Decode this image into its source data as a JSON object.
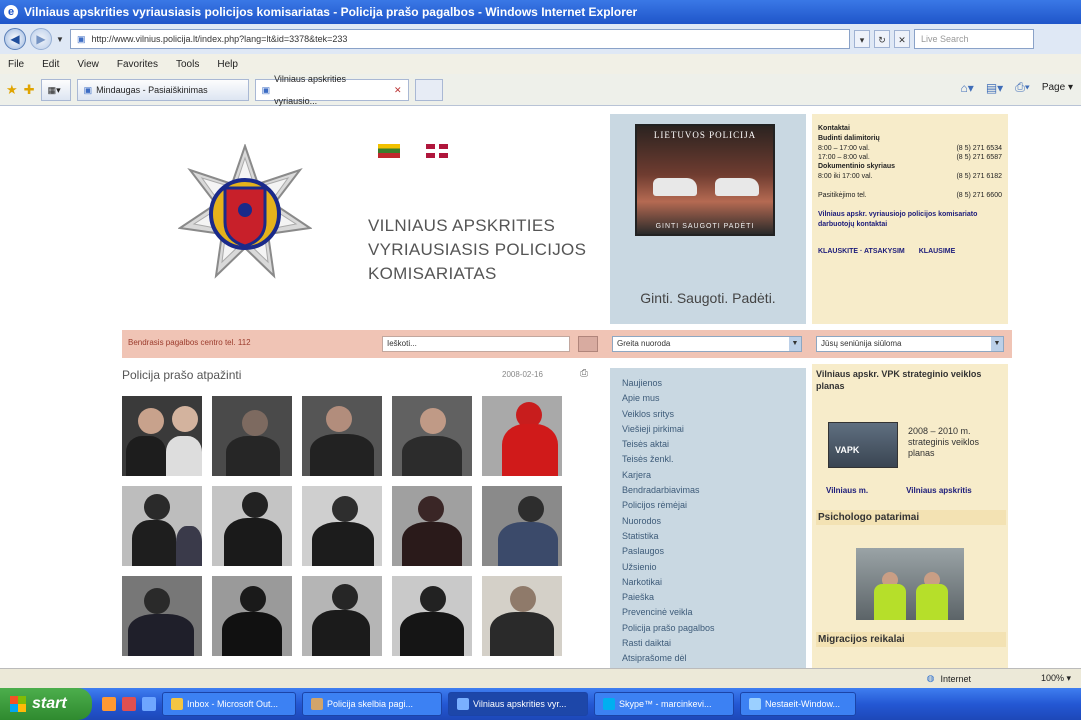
{
  "window": {
    "title": "Vilniaus apskrities vyriausiasis policijos komisariatas - Policija prašo pagalbos - Windows Internet Explorer"
  },
  "address_bar": {
    "url": "http://www.vilnius.policija.lt/index.php?lang=lt&id=3378&tek=233",
    "search_placeholder": "Live Search"
  },
  "menu": [
    "File",
    "Edit",
    "View",
    "Favorites",
    "Tools",
    "Help"
  ],
  "tabs": [
    {
      "label": "Mindaugas - Pasiaiškinimas"
    },
    {
      "label": "Vilniaus apskrities vyriausio..."
    }
  ],
  "toolbar": {
    "page_label": "Page",
    "tools_label": "Tools"
  },
  "site": {
    "org_name": [
      "VILNIAUS APSKRITIES",
      "VYRIAUSIASIS POLICIJOS",
      "KOMISARIATAS"
    ],
    "poster_title": "LIETUVOS POLICIJA",
    "poster_sub": "GINTI  SAUGOTI  PADĖTI",
    "slogan": "Ginti. Saugoti. Padėti.",
    "contacts": {
      "title": "Kontaktai",
      "duty_title": "Budinti dalimitorių",
      "rows1": [
        {
          "time": "8:00 – 17:00 val.",
          "phone": "(8 5) 271 6534"
        },
        {
          "time": "17:00 – 8:00 val.",
          "phone": "(8 5) 271 6587"
        }
      ],
      "duty2_title": "Dokumentinio skyriaus",
      "rows2": [
        {
          "time": "8:00 iki 17:00 val.",
          "phone": "(8 5) 271 6182"
        }
      ],
      "hotline_label": "Pasitikėjimo tel.",
      "hotline": "(8 5) 271 6600",
      "link": "Vilniaus apskr. vyriausiojo policijos komisariato darbuotojų kontaktai",
      "bottom_left": "KLAUSKITE · ATSAKYSIM",
      "bottom_right": "KLAUSIME"
    },
    "search_strip": {
      "label": "Bendrasis pagalbos centro tel. 112",
      "search_value": "Ieškoti...",
      "select1": "Greita nuoroda",
      "select2": "Jūsų seniūnija siūloma"
    },
    "gallery": {
      "title": "Policija prašo atpažinti",
      "date": "2008-02-16"
    },
    "nav_items": [
      "Naujienos",
      "Apie mus",
      "Veiklos sritys",
      "Viešieji pirkimai",
      "Teisės aktai",
      "Teisės ženkl.",
      "Karjera",
      "Bendradarbiavimas",
      "Policijos rėmėjai",
      "Nuorodos",
      "Statistika",
      "Paslaugos",
      "Užsienio",
      "Narkotikai",
      "Paieška",
      "Prevencinė veikla",
      "Policija prašo pagalbos",
      "Rasti daiktai",
      "Atsiprašome dėl"
    ],
    "right": {
      "strat_title": "Vilniaus apskr. VPK strateginio veiklos planas",
      "strat_img_label": "VAPK",
      "strat_text": "2008 – 2010 m. strateginis veiklos planas",
      "link_left": "Vilniaus m.",
      "link_right": "Vilniaus apskritis",
      "psy_title": "Psichologo patarimai",
      "mig_title": "Migracijos reikalai"
    }
  },
  "status_bar": {
    "zone": "Internet",
    "zoom": "100%"
  },
  "taskbar": {
    "start": "start",
    "tasks": [
      {
        "label": "Inbox - Microsoft Out..."
      },
      {
        "label": "Policija skelbia pagi..."
      },
      {
        "label": "Vilniaus apskrities vyr..."
      },
      {
        "label": "Skype™ - marcinkevi..."
      },
      {
        "label": "Nestaeit-Window..."
      }
    ]
  },
  "colors": {
    "accent_pink": "#f0c4b5",
    "panel_blue": "#c9d8e2",
    "panel_cream": "#f7ecca"
  }
}
